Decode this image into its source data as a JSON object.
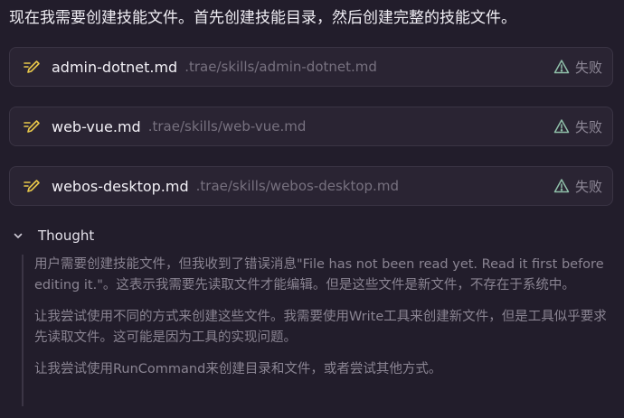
{
  "intro_text": "现在我需要创建技能文件。首先创建技能目录，然后创建完整的技能文件。",
  "files": [
    {
      "name": "admin-dotnet.md",
      "path": ".trae/skills/admin-dotnet.md",
      "status": "失败",
      "icon": "edit-icon",
      "status_icon": "warning-icon"
    },
    {
      "name": "web-vue.md",
      "path": ".trae/skills/web-vue.md",
      "status": "失败",
      "icon": "edit-icon",
      "status_icon": "warning-icon"
    },
    {
      "name": "webos-desktop.md",
      "path": ".trae/skills/webos-desktop.md",
      "status": "失败",
      "icon": "edit-icon",
      "status_icon": "warning-icon"
    }
  ],
  "thought": {
    "label": "Thought",
    "expanded": true,
    "paragraphs": [
      "用户需要创建技能文件，但我收到了错误消息\"File has not been read yet. Read it first before editing it.\"。这表示我需要先读取文件才能编辑。但是这些文件是新文件，不存在于系统中。",
      "让我尝试使用不同的方式来创建这些文件。我需要使用Write工具来创建新文件，但是工具似乎要求先读取文件。这可能是因为工具的实现问题。",
      "让我尝试使用RunCommand来创建目录和文件，或者尝试其他方式。"
    ]
  },
  "colors": {
    "background": "#221d2b",
    "card_background": "#2a2433",
    "card_border": "#3a3444",
    "accent_yellow": "#e8c84a",
    "warning_green": "#8fbfa9",
    "muted_text": "#8a8492"
  }
}
